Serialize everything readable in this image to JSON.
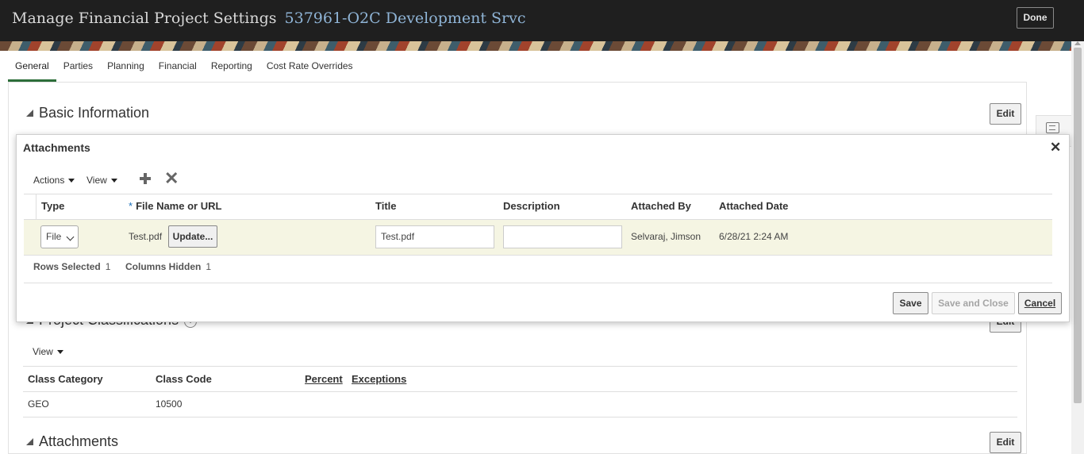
{
  "header": {
    "title": "Manage Financial Project Settings",
    "project": "537961-O2C Development Srvc",
    "done_label": "Done"
  },
  "tabs": [
    {
      "label": "General",
      "active": true
    },
    {
      "label": "Parties"
    },
    {
      "label": "Planning"
    },
    {
      "label": "Financial"
    },
    {
      "label": "Reporting"
    },
    {
      "label": "Cost Rate Overrides"
    }
  ],
  "background": {
    "basic_info_heading": "Basic Information",
    "basic_info_edit": "Edit",
    "classifications_heading": "Project Classifications",
    "classifications_edit": "Edit",
    "classifications_info_icon": "i",
    "view_label": "View",
    "columns": {
      "class_category": "Class Category",
      "class_code": "Class Code",
      "percent": "Percent",
      "exceptions": "Exceptions"
    },
    "row": {
      "class_category": "GEO",
      "class_code": "10500"
    },
    "attachments_heading": "Attachments",
    "attachments_edit": "Edit"
  },
  "dialog": {
    "title": "Attachments",
    "close_label": "✕",
    "toolbar": {
      "actions": "Actions",
      "view": "View"
    },
    "columns": {
      "type": "Type",
      "required_marker": "*",
      "file_name": "File Name or URL",
      "title": "Title",
      "description": "Description",
      "attached_by": "Attached By",
      "attached_date": "Attached Date"
    },
    "row": {
      "type": "File",
      "file_name": "Test.pdf",
      "update_label": "Update...",
      "title": "Test.pdf",
      "description": "",
      "attached_by": "Selvaraj, Jimson",
      "attached_date": "6/28/21 2:24 AM"
    },
    "status": {
      "rows_selected_label": "Rows Selected",
      "rows_selected": "1",
      "columns_hidden_label": "Columns Hidden",
      "columns_hidden": "1"
    },
    "buttons": {
      "save": "Save",
      "save_and_close": "Save and Close",
      "cancel": "Cancel"
    }
  },
  "colors": {
    "header_bg": "#1f1f1f",
    "project_text": "#8fb4d6",
    "active_tab_underline": "#2d6e3a",
    "selected_row": "#f5f5e3"
  }
}
